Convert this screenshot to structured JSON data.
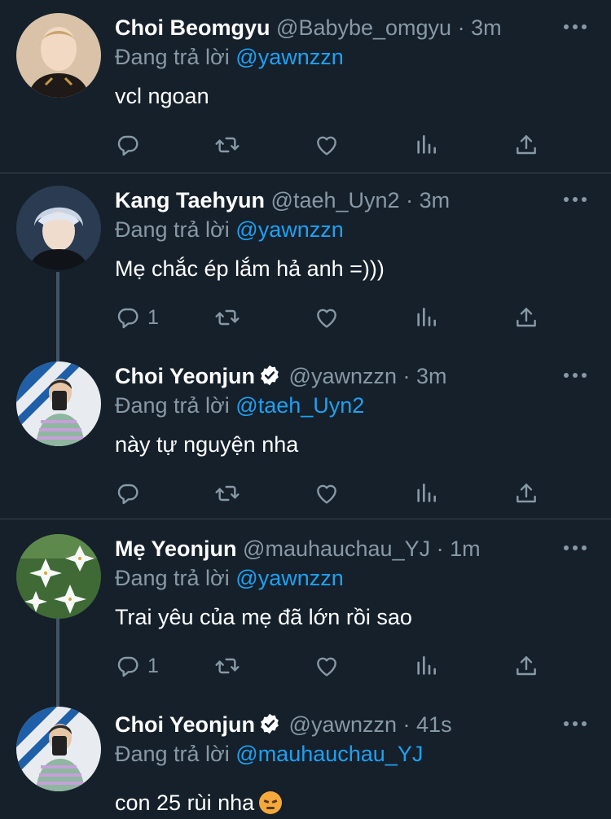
{
  "reply_prefix": "Đang trả lời",
  "tweets": [
    {
      "name": "Choi Beomgyu",
      "handle": "@Babybe_omgyu",
      "sep": "·",
      "time": "3m",
      "replying_to": "@yawnzzn",
      "text": "vcl ngoan",
      "reply_count": "",
      "verified": false,
      "avatar": "avatar-photo"
    },
    {
      "name": "Kang Taehyun",
      "handle": "@taeh_Uyn2",
      "sep": "·",
      "time": "3m",
      "replying_to": "@yawnzzn",
      "text": "Mẹ chắc ép lắm hả anh =)))",
      "reply_count": "1",
      "verified": false,
      "avatar": "avatar-photo"
    },
    {
      "name": "Choi Yeonjun",
      "handle": "@yawnzzn",
      "sep": "·",
      "time": "3m",
      "replying_to": "@taeh_Uyn2",
      "text": "này tự nguyện nha",
      "reply_count": "",
      "verified": true,
      "avatar": "avatar-photo"
    },
    {
      "name": "Mẹ Yeonjun",
      "handle": "@mauhauchau_YJ",
      "sep": "·",
      "time": "1m",
      "replying_to": "@yawnzzn",
      "text": "Trai yêu của mẹ đã lớn rồi sao",
      "reply_count": "1",
      "verified": false,
      "avatar": "lily-flowers"
    },
    {
      "name": "Choi Yeonjun",
      "handle": "@yawnzzn",
      "sep": "·",
      "time": "41s",
      "replying_to": "@mauhauchau_YJ",
      "text": "con 25 rùi nha",
      "emoji": "angry-face",
      "reply_count": "",
      "verified": true,
      "avatar": "avatar-photo"
    }
  ],
  "icons": {
    "reply": "reply-icon",
    "retweet": "retweet-icon",
    "like": "heart-icon",
    "stats": "analytics-icon",
    "share": "share-icon",
    "more": "more-icon",
    "verified": "verified-badge-icon"
  },
  "colors": {
    "background": "#15202b",
    "link": "#1da1f2",
    "muted": "#8899a6",
    "divider": "#38444d"
  }
}
